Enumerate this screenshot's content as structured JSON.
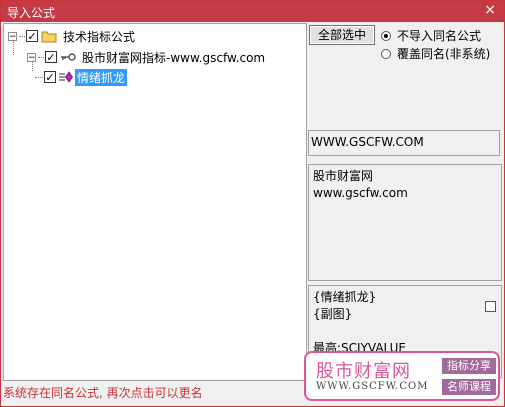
{
  "window": {
    "title": "导入公式",
    "close_glyph": "×"
  },
  "tree": {
    "root": {
      "label": "技术指标公式",
      "expander": "−",
      "checked": "✓"
    },
    "child": {
      "label": "股市财富网指标-www.gscfw.com",
      "expander": "−",
      "checked": "✓"
    },
    "leaf": {
      "label": "情绪抓龙",
      "checked": "✓"
    }
  },
  "buttons": {
    "select_all": "全部选中"
  },
  "options": {
    "no_import_same_name": "不导入同名公式",
    "overwrite_same_name": "覆盖同名(非系统)"
  },
  "info": {
    "site": "WWW.GSCFW.COM",
    "desc_line1": "股市财富网",
    "desc_line2": "www.gscfw.com",
    "code_line1": "{情绪抓龙}",
    "code_line2": "{副图}",
    "code_line3": "最高:SCJYVALUE"
  },
  "status": "系统存在同名公式, 再次点击可以更名",
  "watermark": {
    "name": "股市财富网",
    "url": "WWW.GSCFW.COM",
    "tag1": "指标分享",
    "tag2": "名师课程"
  },
  "colors": {
    "title_bar": "#c33b47",
    "selection": "#3399ff",
    "status_text": "#c8323c",
    "watermark": "#e0559a"
  }
}
